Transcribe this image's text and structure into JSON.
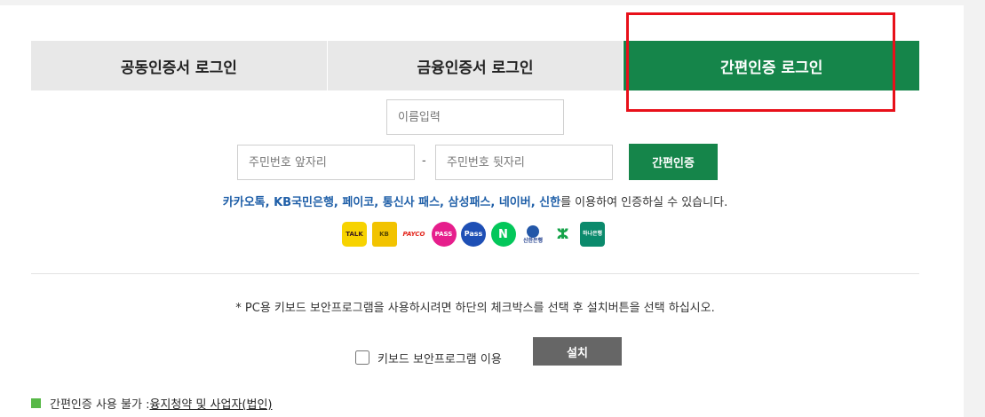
{
  "tabs": [
    {
      "label": "공동인증서 로그인"
    },
    {
      "label": "금융인증서 로그인"
    },
    {
      "label": "간편인증 로그인"
    }
  ],
  "form": {
    "name_placeholder": "이름입력",
    "rrn_front_placeholder": "주민번호 앞자리",
    "rrn_separator": "-",
    "rrn_back_placeholder": "주민번호 뒷자리",
    "auth_button": "간편인증"
  },
  "providers": {
    "names": "카카오톡, KB국민은행, 페이코, 통신사 패스, 삼성패스, 네이버, 신한",
    "suffix": "를 이용하여 인증하실 수 있습니다."
  },
  "logos": [
    {
      "icon": "kakaotalk-icon",
      "text": "TALK"
    },
    {
      "icon": "kb-bank-icon",
      "text": "KB"
    },
    {
      "icon": "payco-icon",
      "text": "PAYCO"
    },
    {
      "icon": "pass-icon",
      "text": "PASS"
    },
    {
      "icon": "samsung-pass-icon",
      "text": "Pass"
    },
    {
      "icon": "naver-icon",
      "text": "N"
    },
    {
      "icon": "shinhan-icon",
      "text": "신한은행"
    },
    {
      "icon": "green-bank-icon",
      "text": "ⵣ"
    },
    {
      "icon": "hana-bank-icon",
      "text": "하나은행"
    }
  ],
  "notice": "* PC용 키보드 보안프로그램을 사용하시려면 하단의 체크박스를 선택 후 설치버튼을 선택 하십시오.",
  "keyboard_security": {
    "label": "키보드 보안프로그램 이용",
    "install_button": "설치"
  },
  "bottom_note": {
    "prefix": "간편인증 사용 불가 : ",
    "link": "융지청약 및 사업자(법인)"
  },
  "colors": {
    "active_tab": "#15854a",
    "highlight": "#e8101a",
    "provider_text": "#1f5fa8"
  }
}
